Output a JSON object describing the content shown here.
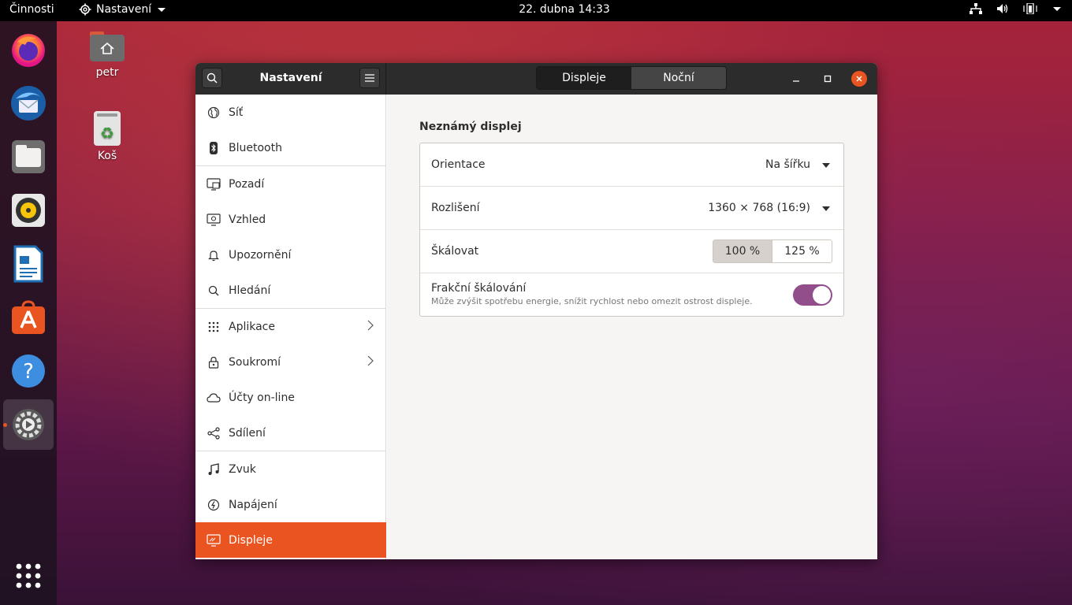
{
  "topbar": {
    "activities": "Činnosti",
    "app_menu": "Nastavení",
    "clock": "22. dubna  14:33"
  },
  "dock": {
    "apps": [
      "firefox",
      "thunderbird",
      "files",
      "rhythmbox",
      "libreoffice-writer",
      "software",
      "help",
      "settings"
    ],
    "active": "settings"
  },
  "desktop": {
    "icons": [
      {
        "label": "petr",
        "icon": "home-folder-icon"
      },
      {
        "label": "Koš",
        "icon": "trash-icon"
      }
    ]
  },
  "window": {
    "title": "Nastavení",
    "tabs": [
      {
        "label": "Displeje",
        "active": true
      },
      {
        "label": "Noční světlo",
        "active": false
      }
    ],
    "sidebar": [
      {
        "label": "Síť",
        "icon": "network-icon"
      },
      {
        "label": "Bluetooth",
        "icon": "bluetooth-icon"
      },
      {
        "label": "Pozadí",
        "icon": "background-icon"
      },
      {
        "label": "Vzhled",
        "icon": "appearance-icon"
      },
      {
        "label": "Upozornění",
        "icon": "bell-icon"
      },
      {
        "label": "Hledání",
        "icon": "search-icon"
      },
      {
        "label": "Aplikace",
        "icon": "grid-icon",
        "chevron": true
      },
      {
        "label": "Soukromí",
        "icon": "lock-icon",
        "chevron": true
      },
      {
        "label": "Účty on-line",
        "icon": "cloud-icon"
      },
      {
        "label": "Sdílení",
        "icon": "share-icon"
      },
      {
        "label": "Zvuk",
        "icon": "music-note-icon"
      },
      {
        "label": "Napájení",
        "icon": "power-icon"
      },
      {
        "label": "Displeje",
        "icon": "display-icon",
        "selected": true
      }
    ],
    "display": {
      "name": "Neznámý displej",
      "orientation_label": "Orientace",
      "orientation_value": "Na šířku",
      "resolution_label": "Rozlišení",
      "resolution_value": "1360 × 768 (16:9)",
      "scale_label": "Škálovat",
      "scale_options": [
        "100 %",
        "125 %"
      ],
      "scale_selected": "100 %",
      "fractional_label": "Frakční škálování",
      "fractional_desc": "Může zvýšit spotřebu energie, snížit rychlost nebo omezit ostrost displeje.",
      "fractional_enabled": true
    }
  },
  "colors": {
    "accent": "#e95420",
    "toggle_on": "#924d8b",
    "headerbar": "#2c2c2c"
  }
}
